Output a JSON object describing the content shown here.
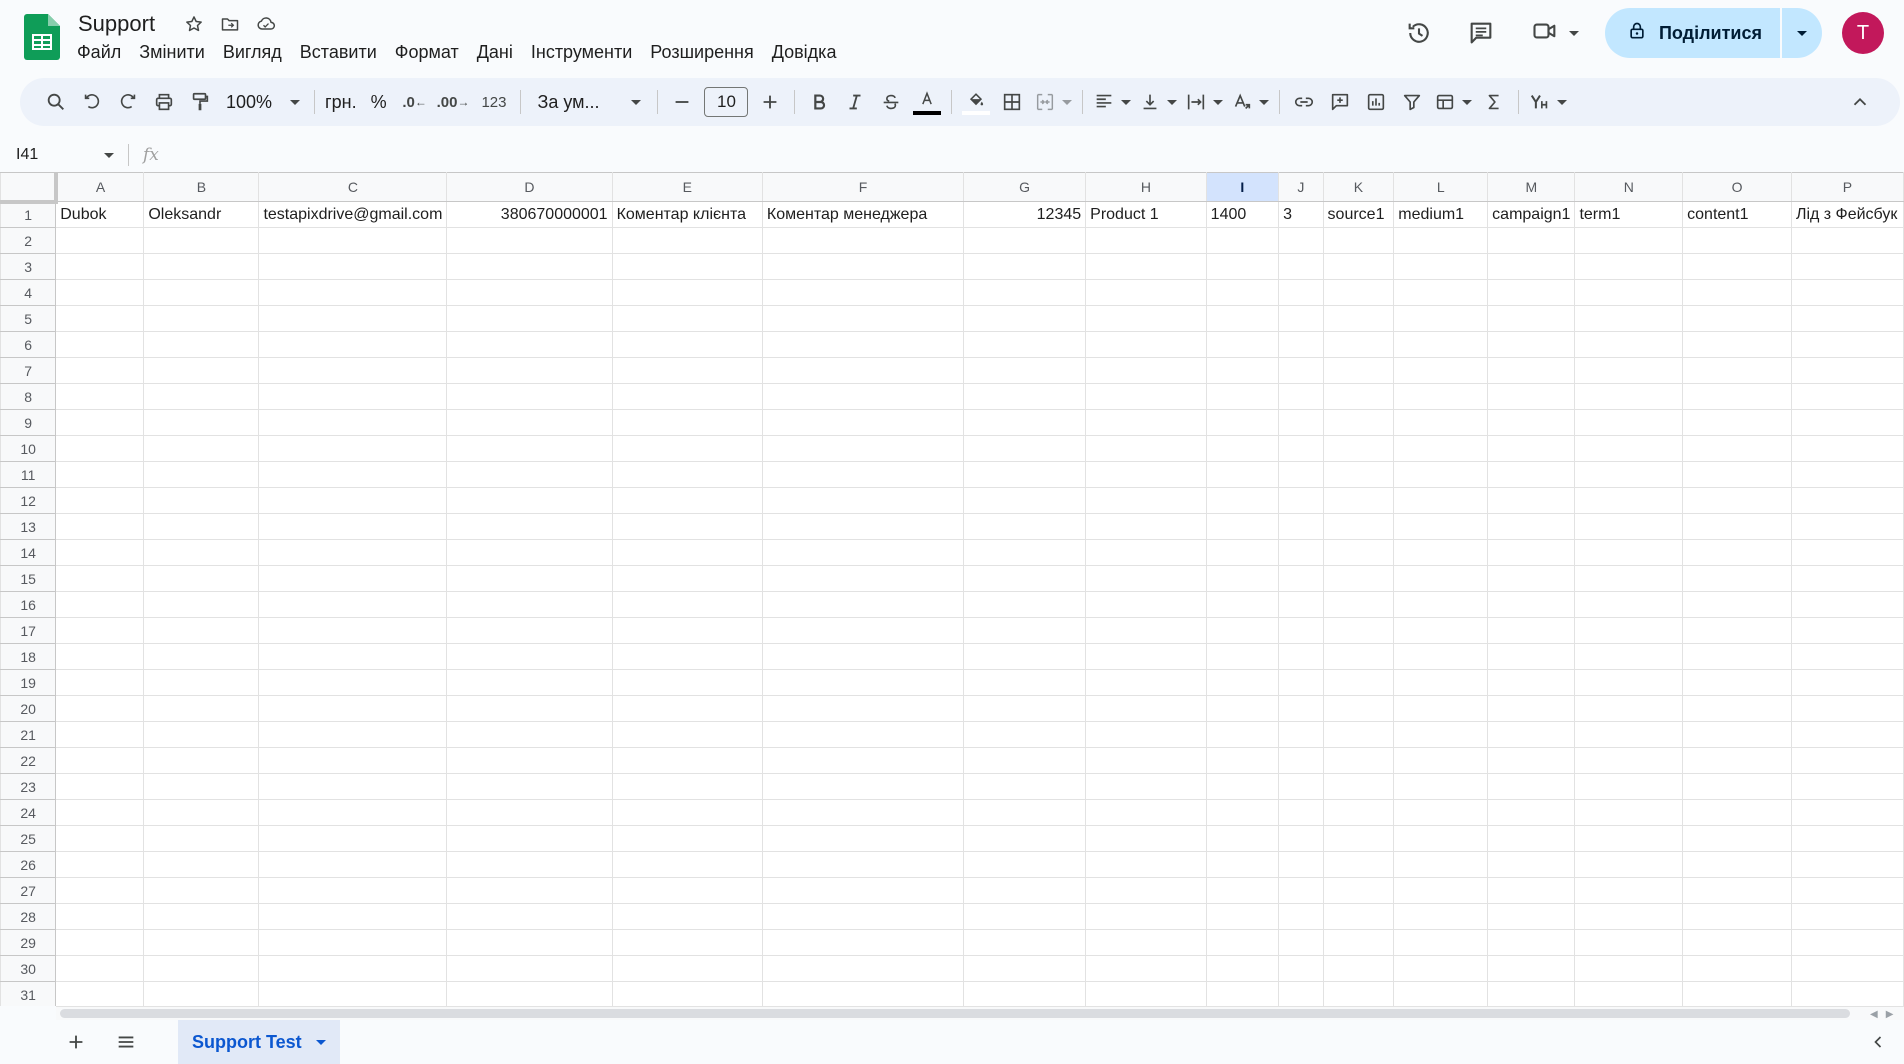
{
  "app": {
    "doc_title": "Support",
    "menu": [
      "Файл",
      "Змінити",
      "Вигляд",
      "Вставити",
      "Формат",
      "Дані",
      "Інструменти",
      "Розширення",
      "Довідка"
    ],
    "share_label": "Поділитися",
    "avatar_letter": "T"
  },
  "toolbar": {
    "zoom": "100%",
    "currency": "грн.",
    "percent": "%",
    "decrease_decimals": ".0",
    "increase_decimals": ".00",
    "number_format": "123",
    "font": "За ум...",
    "font_size": "10"
  },
  "formula_bar": {
    "cell_ref": "I41",
    "fx_label": "fx",
    "value": ""
  },
  "grid": {
    "columns": [
      "A",
      "B",
      "C",
      "D",
      "E",
      "F",
      "G",
      "H",
      "I",
      "J",
      "K",
      "L",
      "M",
      "N",
      "O",
      "P"
    ],
    "selected_column": "I",
    "row_count": 31,
    "row1": [
      "Dubok",
      "Oleksandr",
      "testapixdrive@gmail.com",
      "380670000001",
      "Коментар клієнта",
      "Коментар менеджера",
      "12345",
      "Product 1",
      "1400",
      "3",
      "source1",
      "medium1",
      "campaign1",
      "term1",
      "content1",
      "Лід з Фейсбук"
    ]
  },
  "sheets": {
    "active_tab": "Support Test"
  },
  "colors": {
    "accent": "#0b57d0",
    "share_bg": "#c2e7ff",
    "avatar_bg": "#c2185b",
    "selected_header": "#d3e3fd",
    "sheets_green": "#0f9d58"
  }
}
